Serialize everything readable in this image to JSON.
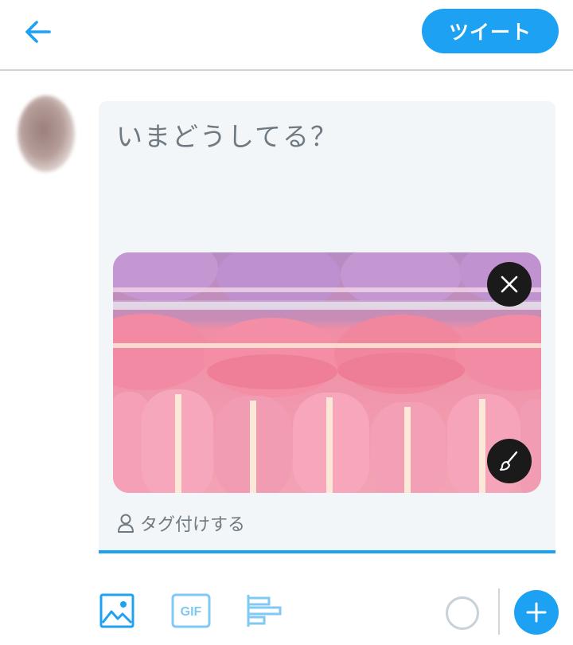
{
  "header": {
    "back_icon": "arrow-left-icon",
    "tweet_label": "ツイート"
  },
  "compose": {
    "placeholder": "いまどうしてる？",
    "media": {
      "alt_description": "",
      "remove_icon": "close-icon",
      "edit_icon": "paintbrush-icon"
    },
    "tag_label": "タグ付けする",
    "tag_icon": "person-icon"
  },
  "toolbar": {
    "items": [
      {
        "icon": "image-icon"
      },
      {
        "icon": "gif-icon",
        "label": "GIF"
      },
      {
        "icon": "poll-icon"
      }
    ],
    "add_icon": "plus-icon"
  },
  "colors": {
    "accent": "#1da1f2",
    "compose_bg": "#f3f6f8",
    "muted_text": "#6f7a82"
  }
}
